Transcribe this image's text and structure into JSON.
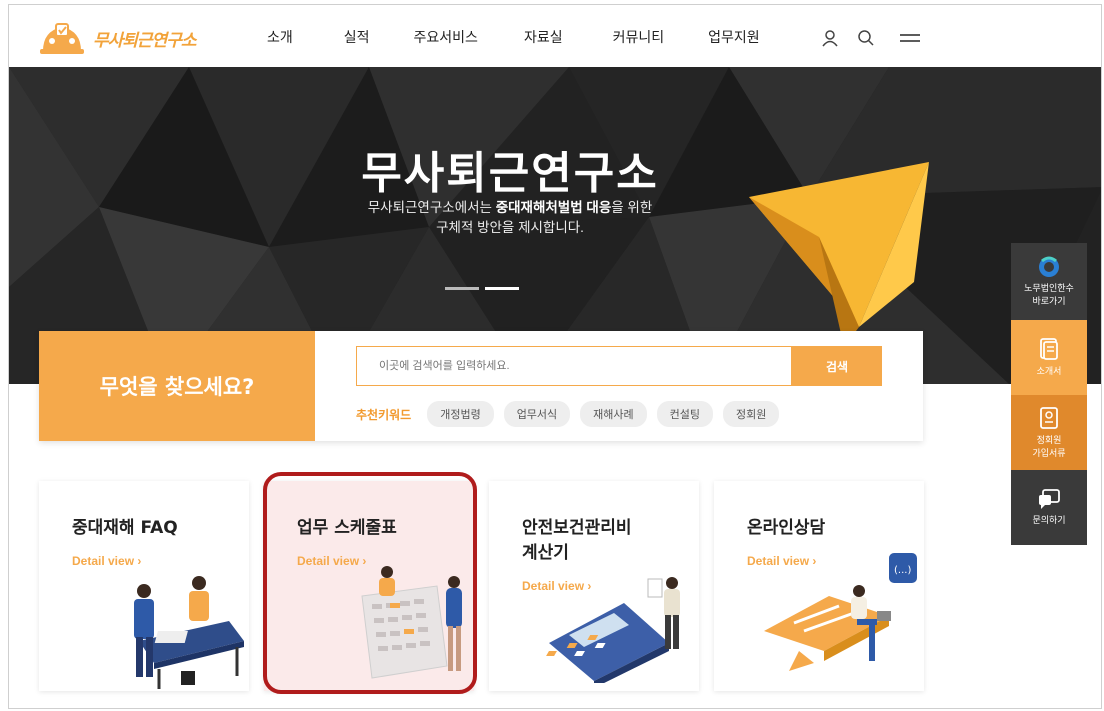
{
  "brand": {
    "name": "무사퇴근연구소"
  },
  "nav": {
    "items": [
      "소개",
      "실적",
      "주요서비스",
      "자료실",
      "커뮤니티",
      "업무지원"
    ]
  },
  "header_icons": [
    "user-icon",
    "search-icon",
    "menu-icon"
  ],
  "hero": {
    "title": "무사퇴근연구소",
    "sub_line1_pre": "무사퇴근연구소에서는 ",
    "sub_line1_bold": "중대재해처벌법 대응",
    "sub_line1_post": "을 위한",
    "sub_line2": "구체적 방안을 제시합니다.",
    "slides": 2,
    "active_slide": 2
  },
  "search": {
    "heading": "무엇을 찾으세요?",
    "placeholder": "이곳에 검색어를 입력하세요.",
    "button": "검색",
    "keyword_label": "추천키워드",
    "keywords": [
      "개정법령",
      "업무서식",
      "재해사례",
      "컨설팅",
      "정회원"
    ]
  },
  "cards": [
    {
      "title_line1": "중대재해 FAQ",
      "title_line2": "",
      "link": "Detail view ›"
    },
    {
      "title_line1": "업무 스케줄표",
      "title_line2": "",
      "link": "Detail view ›",
      "highlighted": true
    },
    {
      "title_line1": "안전보건관리비",
      "title_line2": "계산기",
      "link": "Detail view ›"
    },
    {
      "title_line1": "온라인상담",
      "title_line2": "",
      "link": "Detail view ›"
    }
  ],
  "quick_menu": [
    {
      "line1": "노무법인한수",
      "line2": "바로가기",
      "icon": "logo-circle-icon",
      "bg": "#3a3a3a"
    },
    {
      "line1": "소개서",
      "line2": "",
      "icon": "document-icon",
      "bg": "#f5a94b"
    },
    {
      "line1": "정회원",
      "line2": "가입서류",
      "icon": "id-card-icon",
      "bg": "#e0892c"
    },
    {
      "line1": "문의하기",
      "line2": "",
      "icon": "chat-icon",
      "bg": "#3a3a3a"
    }
  ],
  "colors": {
    "accent": "#f5a94b",
    "accent_dark": "#e0892c",
    "dark": "#3a3a3a",
    "highlight_border": "#b01c1c"
  }
}
